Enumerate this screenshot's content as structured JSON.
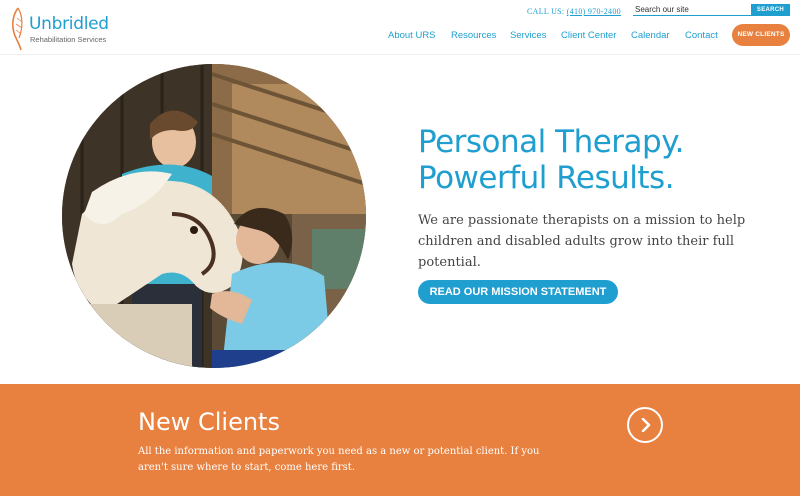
{
  "brand": {
    "name": "Unbridled",
    "tagline": "Rehabilitation Services",
    "primary_color": "#1f9ed0",
    "accent_color": "#e8803f"
  },
  "header": {
    "call_label": "CALL US:",
    "phone": "(410) 970-2400",
    "search": {
      "placeholder": "Search our site",
      "button_label": "SEARCH"
    },
    "nav": [
      {
        "label": "About URS"
      },
      {
        "label": "Resources"
      },
      {
        "label": "Services"
      },
      {
        "label": "Client Center"
      },
      {
        "label": "Calendar"
      },
      {
        "label": "Contact"
      }
    ],
    "cta_label": "NEW CLIENTS"
  },
  "hero": {
    "title_line1": "Personal Therapy.",
    "title_line2": "Powerful Results.",
    "description": "We are passionate therapists on a mission to help children and disabled adults grow into their full potential.",
    "button_label": "READ OUR MISSION STATEMENT",
    "image_icon": "hero-photo-therapy-horse"
  },
  "band": {
    "title": "New Clients",
    "description": "All the information and paperwork you need as a new or potential client. If you aren't sure where to start, come here first.",
    "arrow_icon": "chevron-right-icon"
  }
}
